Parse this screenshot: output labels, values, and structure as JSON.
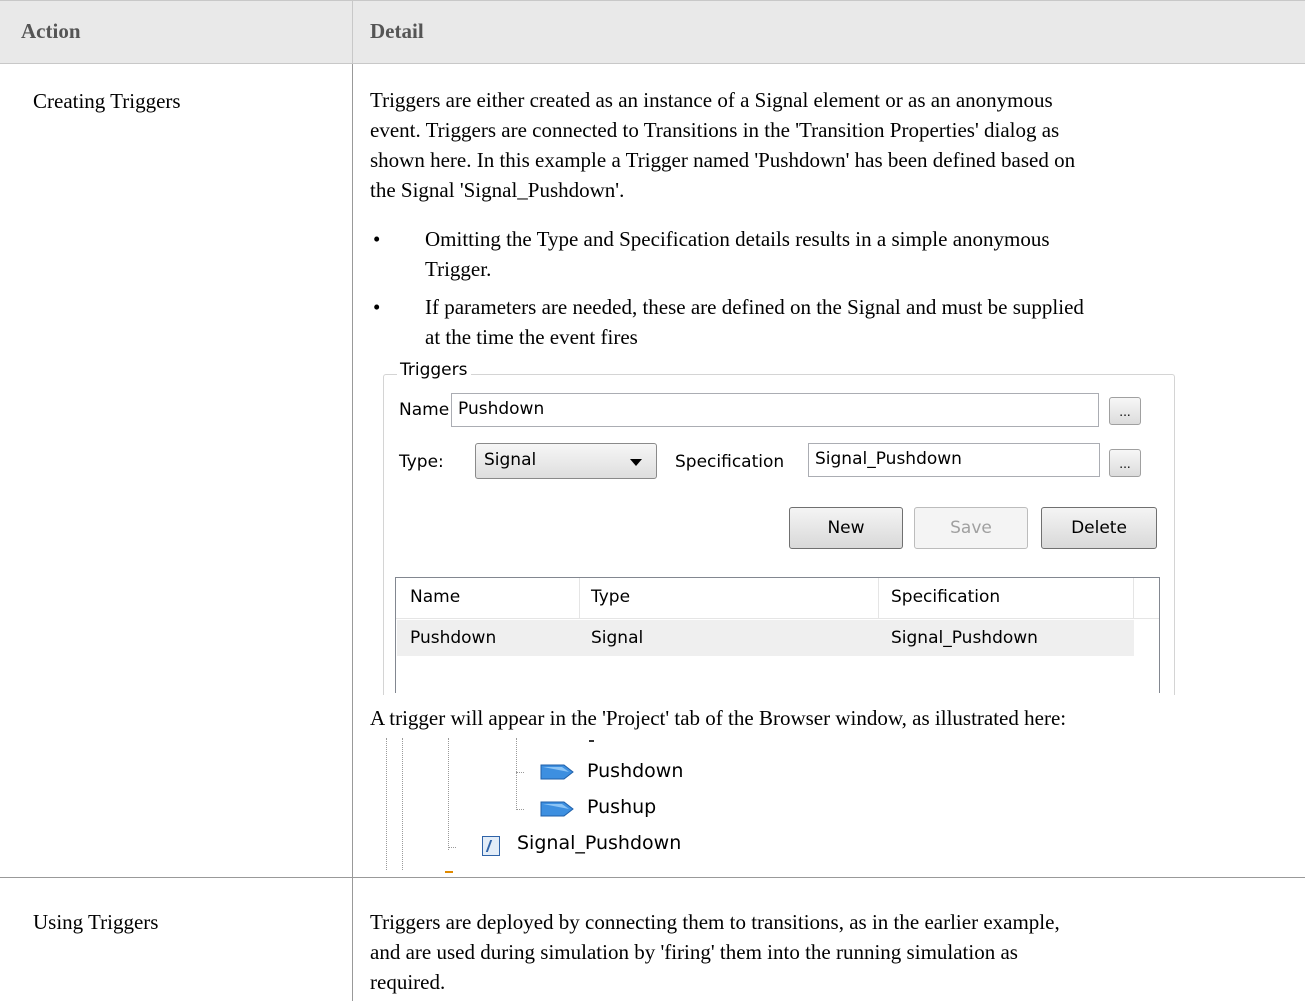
{
  "table": {
    "headers": {
      "action": "Action",
      "detail": "Detail"
    },
    "rows": [
      {
        "action": "Creating Triggers",
        "intro": "Triggers are either created as an instance of a Signal element or as an anonymous event. Triggers are connected to Transitions in the 'Transition Properties' dialog as shown here. In this example a Trigger named 'Pushdown' has been defined based on the Signal 'Signal_Pushdown'.",
        "intro_lines": [
          "Triggers are either created as an instance of a Signal element or as an anonymous",
          "event. Triggers are connected to Transitions in the 'Transition Properties' dialog as",
          "shown here. In this example a Trigger named 'Pushdown' has been defined based on",
          "the Signal 'Signal_Pushdown'."
        ],
        "bullets": [
          {
            "lines": [
              "Omitting the Type and Specification details results in a simple anonymous",
              "Trigger."
            ]
          },
          {
            "lines": [
              "If parameters are needed, these are defined on the Signal and must be supplied",
              "at the time the event fires"
            ]
          }
        ],
        "after_dialog": "A trigger will appear in the 'Project' tab of the Browser window, as illustrated here:"
      },
      {
        "action": "Using Triggers",
        "lines": [
          "Triggers are deployed by connecting them to transitions, as in the earlier example,",
          "and are used during simulation by 'firing' them into the running simulation as",
          "required."
        ]
      }
    ]
  },
  "dialog": {
    "group_label": "Triggers",
    "name_label": "Name:",
    "name_value": "Pushdown",
    "type_label": "Type:",
    "type_value": "Signal",
    "spec_label": "Specification",
    "spec_value": "Signal_Pushdown",
    "ellipsis": "...",
    "buttons": {
      "new": "New",
      "save": "Save",
      "delete": "Delete"
    },
    "list": {
      "columns": [
        "Name",
        "Type",
        "Specification"
      ],
      "rows": [
        {
          "name": "Pushdown",
          "type": "Signal",
          "spec": "Signal_Pushdown"
        }
      ]
    }
  },
  "tree": {
    "items": [
      {
        "label": "Pushdown",
        "icon": "trigger-icon"
      },
      {
        "label": "Pushup",
        "icon": "trigger-icon"
      },
      {
        "label": "Signal_Pushdown",
        "icon": "signal-icon"
      }
    ]
  },
  "colors": {
    "header_bg": "#e9e9e9",
    "trigger_icon": "#3d8fe0",
    "signal_icon": "#2f63a8"
  }
}
